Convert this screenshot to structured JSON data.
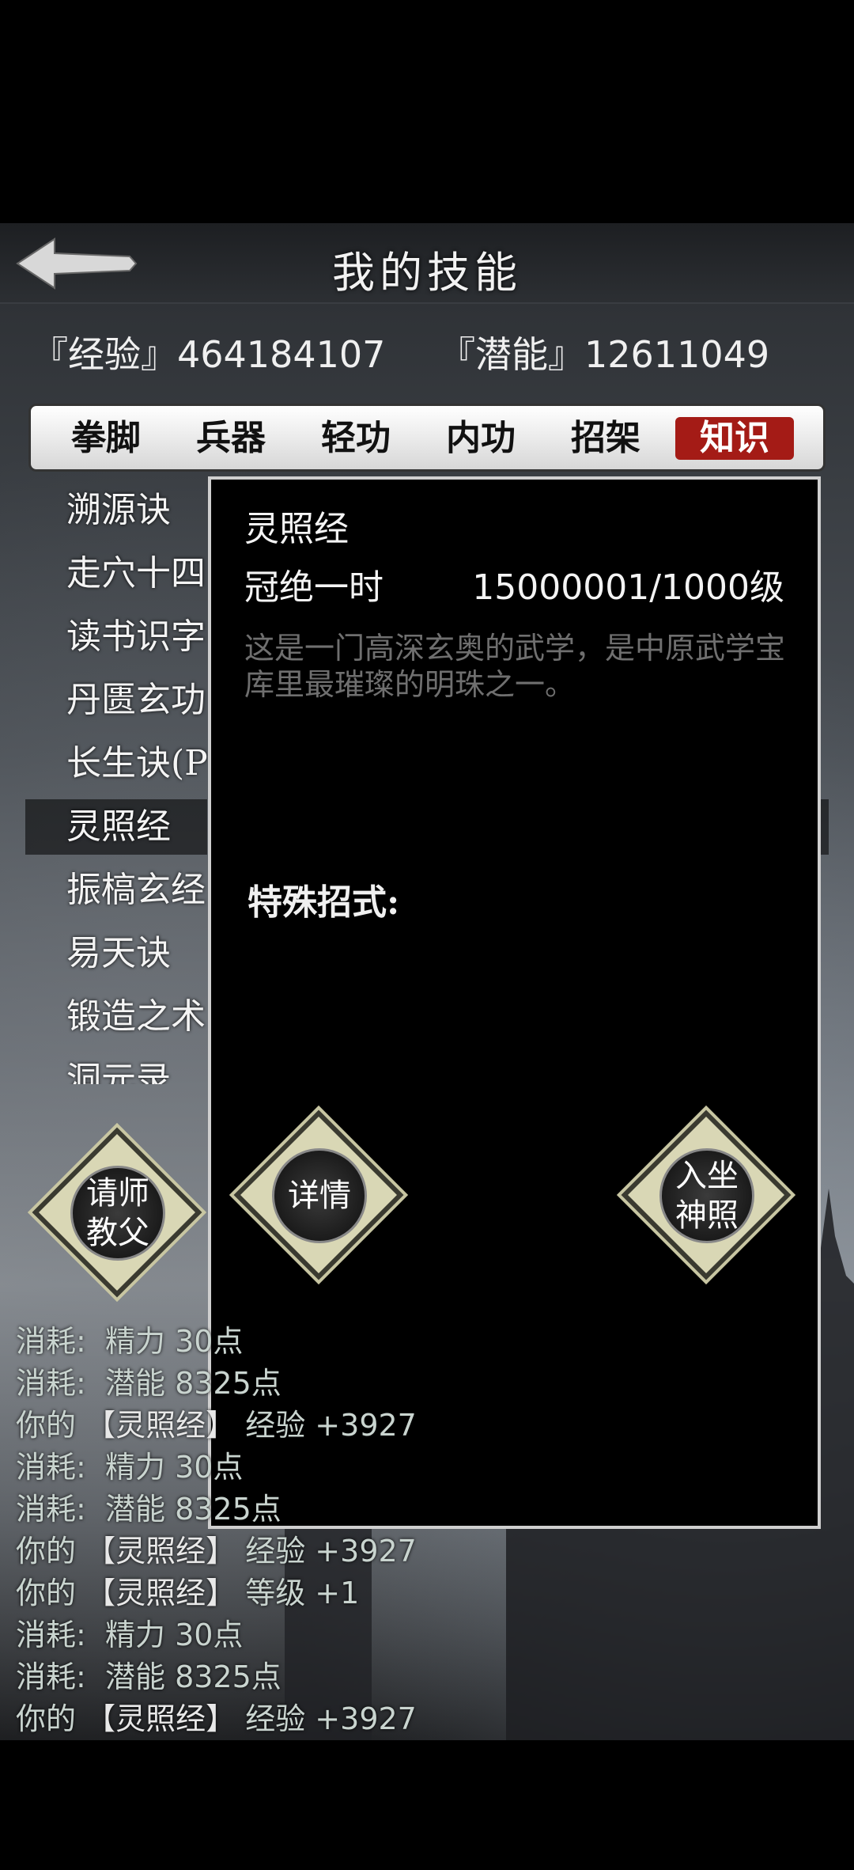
{
  "header": {
    "title": "我的技能",
    "back_icon": "back-arrow-icon"
  },
  "stats": {
    "experience_label": "『经验』464184107",
    "potential_label": "『潜能』12611049"
  },
  "tabs": [
    {
      "label": "拳脚",
      "active": false
    },
    {
      "label": "兵器",
      "active": false
    },
    {
      "label": "轻功",
      "active": false
    },
    {
      "label": "内功",
      "active": false
    },
    {
      "label": "招架",
      "active": false
    },
    {
      "label": "知识",
      "active": true
    }
  ],
  "skills": [
    {
      "label": "溯源诀"
    },
    {
      "label": "走穴十四"
    },
    {
      "label": "读书识字"
    },
    {
      "label": "丹匮玄功"
    },
    {
      "label": "长生诀(P"
    },
    {
      "label": "灵照经",
      "selected": true
    },
    {
      "label": "振槁玄经"
    },
    {
      "label": "易天诀"
    },
    {
      "label": "锻造之术"
    },
    {
      "label": "洞元录"
    }
  ],
  "buttons": {
    "teacher": {
      "line1": "请师",
      "line2": "教父"
    },
    "detail": {
      "line1": "详情"
    },
    "meditate": {
      "line1": "入坐",
      "line2": "神照"
    }
  },
  "popup": {
    "skill_name": "灵照经",
    "rank": "冠绝一时",
    "level": "15000001/1000级",
    "description": "这是一门高深玄奥的武学，是中原武学宝库里最璀璨的明珠之一。",
    "special_moves_label": "特殊招式:"
  },
  "log": [
    {
      "prefix": "消耗:",
      "text": "精力 30点"
    },
    {
      "prefix": "消耗:",
      "text": "潜能 8325点"
    },
    {
      "prefix": "你的",
      "skill": "【灵照经】",
      "text": "经验 +3927"
    },
    {
      "prefix": "消耗:",
      "text": "精力 30点"
    },
    {
      "prefix": "消耗:",
      "text": "潜能 8325点"
    },
    {
      "prefix": "你的",
      "skill": "【灵照经】",
      "text": "经验 +3927"
    },
    {
      "prefix": "你的",
      "skill": "【灵照经】",
      "text": "等级 +1"
    },
    {
      "prefix": "消耗:",
      "text": "精力 30点"
    },
    {
      "prefix": "消耗:",
      "text": "潜能 8325点"
    },
    {
      "prefix": "你的",
      "skill": "【灵照经】",
      "text": "经验 +3927"
    }
  ],
  "colors": {
    "active_tab": "#a41b16",
    "diamond_fill": "#d9d7b5",
    "log_text": "#c9d4cf",
    "description_text": "#6f6f6f"
  }
}
